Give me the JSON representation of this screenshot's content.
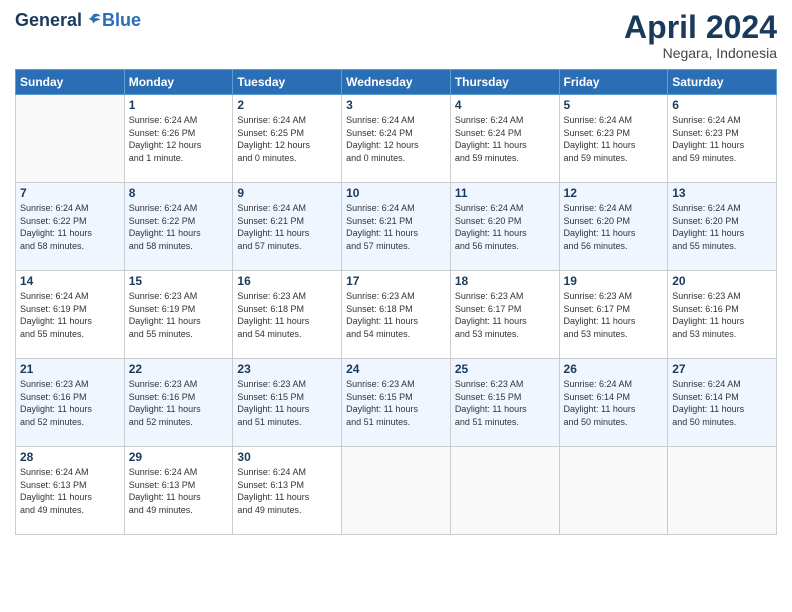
{
  "header": {
    "logo_general": "General",
    "logo_blue": "Blue",
    "month": "April 2024",
    "location": "Negara, Indonesia"
  },
  "weekdays": [
    "Sunday",
    "Monday",
    "Tuesday",
    "Wednesday",
    "Thursday",
    "Friday",
    "Saturday"
  ],
  "weeks": [
    [
      {
        "day": "",
        "lines": []
      },
      {
        "day": "1",
        "lines": [
          "Sunrise: 6:24 AM",
          "Sunset: 6:26 PM",
          "Daylight: 12 hours",
          "and 1 minute."
        ]
      },
      {
        "day": "2",
        "lines": [
          "Sunrise: 6:24 AM",
          "Sunset: 6:25 PM",
          "Daylight: 12 hours",
          "and 0 minutes."
        ]
      },
      {
        "day": "3",
        "lines": [
          "Sunrise: 6:24 AM",
          "Sunset: 6:24 PM",
          "Daylight: 12 hours",
          "and 0 minutes."
        ]
      },
      {
        "day": "4",
        "lines": [
          "Sunrise: 6:24 AM",
          "Sunset: 6:24 PM",
          "Daylight: 11 hours",
          "and 59 minutes."
        ]
      },
      {
        "day": "5",
        "lines": [
          "Sunrise: 6:24 AM",
          "Sunset: 6:23 PM",
          "Daylight: 11 hours",
          "and 59 minutes."
        ]
      },
      {
        "day": "6",
        "lines": [
          "Sunrise: 6:24 AM",
          "Sunset: 6:23 PM",
          "Daylight: 11 hours",
          "and 59 minutes."
        ]
      }
    ],
    [
      {
        "day": "7",
        "lines": [
          "Sunrise: 6:24 AM",
          "Sunset: 6:22 PM",
          "Daylight: 11 hours",
          "and 58 minutes."
        ]
      },
      {
        "day": "8",
        "lines": [
          "Sunrise: 6:24 AM",
          "Sunset: 6:22 PM",
          "Daylight: 11 hours",
          "and 58 minutes."
        ]
      },
      {
        "day": "9",
        "lines": [
          "Sunrise: 6:24 AM",
          "Sunset: 6:21 PM",
          "Daylight: 11 hours",
          "and 57 minutes."
        ]
      },
      {
        "day": "10",
        "lines": [
          "Sunrise: 6:24 AM",
          "Sunset: 6:21 PM",
          "Daylight: 11 hours",
          "and 57 minutes."
        ]
      },
      {
        "day": "11",
        "lines": [
          "Sunrise: 6:24 AM",
          "Sunset: 6:20 PM",
          "Daylight: 11 hours",
          "and 56 minutes."
        ]
      },
      {
        "day": "12",
        "lines": [
          "Sunrise: 6:24 AM",
          "Sunset: 6:20 PM",
          "Daylight: 11 hours",
          "and 56 minutes."
        ]
      },
      {
        "day": "13",
        "lines": [
          "Sunrise: 6:24 AM",
          "Sunset: 6:20 PM",
          "Daylight: 11 hours",
          "and 55 minutes."
        ]
      }
    ],
    [
      {
        "day": "14",
        "lines": [
          "Sunrise: 6:24 AM",
          "Sunset: 6:19 PM",
          "Daylight: 11 hours",
          "and 55 minutes."
        ]
      },
      {
        "day": "15",
        "lines": [
          "Sunrise: 6:23 AM",
          "Sunset: 6:19 PM",
          "Daylight: 11 hours",
          "and 55 minutes."
        ]
      },
      {
        "day": "16",
        "lines": [
          "Sunrise: 6:23 AM",
          "Sunset: 6:18 PM",
          "Daylight: 11 hours",
          "and 54 minutes."
        ]
      },
      {
        "day": "17",
        "lines": [
          "Sunrise: 6:23 AM",
          "Sunset: 6:18 PM",
          "Daylight: 11 hours",
          "and 54 minutes."
        ]
      },
      {
        "day": "18",
        "lines": [
          "Sunrise: 6:23 AM",
          "Sunset: 6:17 PM",
          "Daylight: 11 hours",
          "and 53 minutes."
        ]
      },
      {
        "day": "19",
        "lines": [
          "Sunrise: 6:23 AM",
          "Sunset: 6:17 PM",
          "Daylight: 11 hours",
          "and 53 minutes."
        ]
      },
      {
        "day": "20",
        "lines": [
          "Sunrise: 6:23 AM",
          "Sunset: 6:16 PM",
          "Daylight: 11 hours",
          "and 53 minutes."
        ]
      }
    ],
    [
      {
        "day": "21",
        "lines": [
          "Sunrise: 6:23 AM",
          "Sunset: 6:16 PM",
          "Daylight: 11 hours",
          "and 52 minutes."
        ]
      },
      {
        "day": "22",
        "lines": [
          "Sunrise: 6:23 AM",
          "Sunset: 6:16 PM",
          "Daylight: 11 hours",
          "and 52 minutes."
        ]
      },
      {
        "day": "23",
        "lines": [
          "Sunrise: 6:23 AM",
          "Sunset: 6:15 PM",
          "Daylight: 11 hours",
          "and 51 minutes."
        ]
      },
      {
        "day": "24",
        "lines": [
          "Sunrise: 6:23 AM",
          "Sunset: 6:15 PM",
          "Daylight: 11 hours",
          "and 51 minutes."
        ]
      },
      {
        "day": "25",
        "lines": [
          "Sunrise: 6:23 AM",
          "Sunset: 6:15 PM",
          "Daylight: 11 hours",
          "and 51 minutes."
        ]
      },
      {
        "day": "26",
        "lines": [
          "Sunrise: 6:24 AM",
          "Sunset: 6:14 PM",
          "Daylight: 11 hours",
          "and 50 minutes."
        ]
      },
      {
        "day": "27",
        "lines": [
          "Sunrise: 6:24 AM",
          "Sunset: 6:14 PM",
          "Daylight: 11 hours",
          "and 50 minutes."
        ]
      }
    ],
    [
      {
        "day": "28",
        "lines": [
          "Sunrise: 6:24 AM",
          "Sunset: 6:13 PM",
          "Daylight: 11 hours",
          "and 49 minutes."
        ]
      },
      {
        "day": "29",
        "lines": [
          "Sunrise: 6:24 AM",
          "Sunset: 6:13 PM",
          "Daylight: 11 hours",
          "and 49 minutes."
        ]
      },
      {
        "day": "30",
        "lines": [
          "Sunrise: 6:24 AM",
          "Sunset: 6:13 PM",
          "Daylight: 11 hours",
          "and 49 minutes."
        ]
      },
      {
        "day": "",
        "lines": []
      },
      {
        "day": "",
        "lines": []
      },
      {
        "day": "",
        "lines": []
      },
      {
        "day": "",
        "lines": []
      }
    ]
  ]
}
